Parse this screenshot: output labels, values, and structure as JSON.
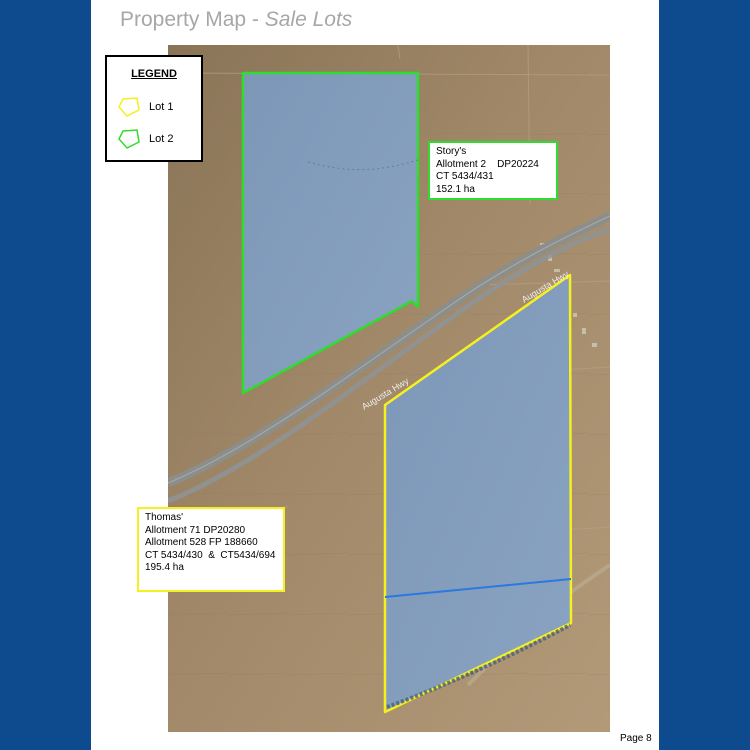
{
  "title": {
    "main": "Property Map - ",
    "sub": "Sale Lots"
  },
  "legend": {
    "heading": "LEGEND",
    "items": [
      {
        "label": "Lot 1",
        "color": "#f5f01e"
      },
      {
        "label": "Lot 2",
        "color": "#2edd2e"
      }
    ]
  },
  "callouts": {
    "story": {
      "lines": [
        "Story's",
        "Allotment 2    DP20224",
        "CT 5434/431",
        "152.1 ha"
      ],
      "border_color": "#2edd2e"
    },
    "thomas": {
      "lines": [
        "Thomas'",
        "Allotment 71 DP20280",
        "Allotment 528 FP 188660",
        "CT 5434/430  &  CT5434/694",
        "195.4 ha"
      ],
      "border_color": "#f5f01e"
    }
  },
  "road": {
    "label": "Augusta Hwy"
  },
  "colors": {
    "background": "#0d4a8e",
    "terrain": "#9a8366",
    "lot_fill": "#7f9bbe",
    "lot1_border": "#f5f01e",
    "lot2_border": "#2edd2e",
    "divider": "#2a78e0"
  },
  "page_number": "Page 8"
}
